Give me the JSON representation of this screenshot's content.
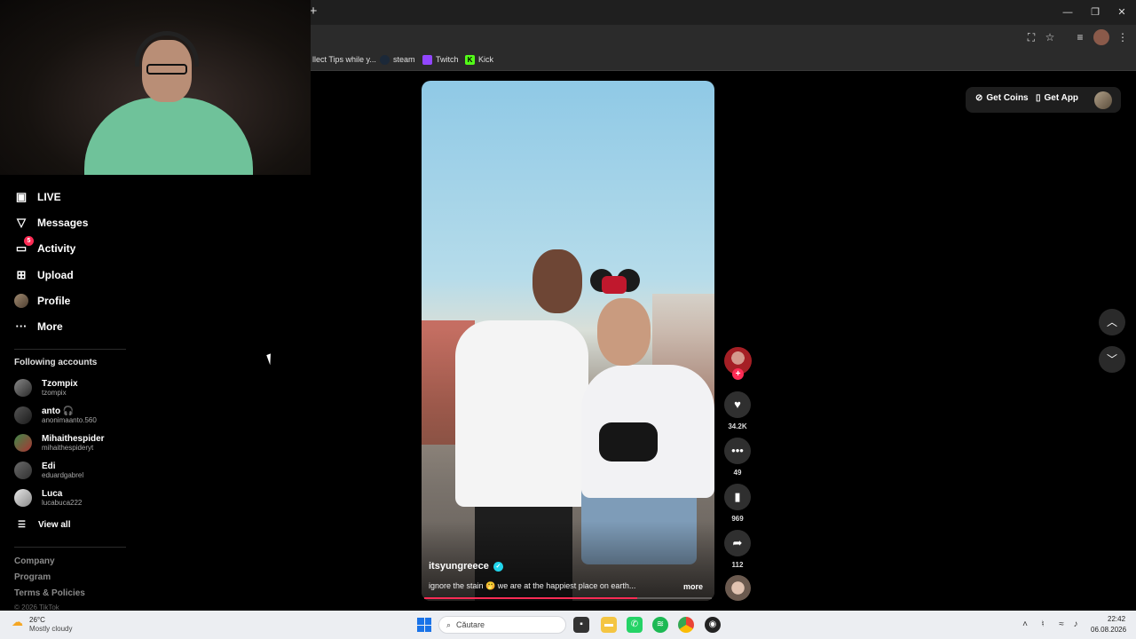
{
  "browser": {
    "new_tab_glyph": "+",
    "window_controls": [
      "—",
      "❐",
      "✕"
    ],
    "bookmarks": [
      {
        "label": "llect Tips while y...",
        "icon": "collect-icon"
      },
      {
        "label": "steam",
        "icon": "steam-icon"
      },
      {
        "label": "Twitch",
        "icon": "twitch-icon"
      },
      {
        "label": "Kick",
        "icon": "kick-icon",
        "icon_text": "K"
      }
    ]
  },
  "sidebar": {
    "nav": [
      {
        "label": "LIVE",
        "icon": "live-icon"
      },
      {
        "label": "Messages",
        "icon": "messages-icon"
      },
      {
        "label": "Activity",
        "icon": "activity-icon",
        "badge": "5"
      },
      {
        "label": "Upload",
        "icon": "upload-icon"
      },
      {
        "label": "Profile",
        "icon": "profile-avatar"
      },
      {
        "label": "More",
        "icon": "more-icon"
      }
    ],
    "following_title": "Following accounts",
    "following": [
      {
        "name": "Tzompix",
        "username": "tzompix"
      },
      {
        "name": "anto 🎧",
        "username": "anonimaanto.560"
      },
      {
        "name": "Mihaithespider",
        "username": "mihaithespideryt"
      },
      {
        "name": "Edi",
        "username": "eduardgabrel"
      },
      {
        "name": "Luca",
        "username": "lucabuca222"
      }
    ],
    "view_all": "View all",
    "footer": [
      "Company",
      "Program",
      "Terms & Policies"
    ],
    "copyright": "© 2026 TikTok"
  },
  "video": {
    "username": "itsyungreece",
    "verified_glyph": "✓",
    "caption": "ignore the stain 🤭 we are at the happiest place on earth...",
    "more": "more",
    "progress": 0.74,
    "follow_plus": "+",
    "likes": "34.2K",
    "comments": "49",
    "saves": "969",
    "shares": "112"
  },
  "topbar": {
    "get_coins": "Get Coins",
    "get_app": "Get App"
  },
  "taskbar": {
    "weather_temp": "26°C",
    "weather_desc": "Mostly cloudy",
    "search_placeholder": "Căutare",
    "time": "22:42",
    "date": "06.08.2026"
  }
}
